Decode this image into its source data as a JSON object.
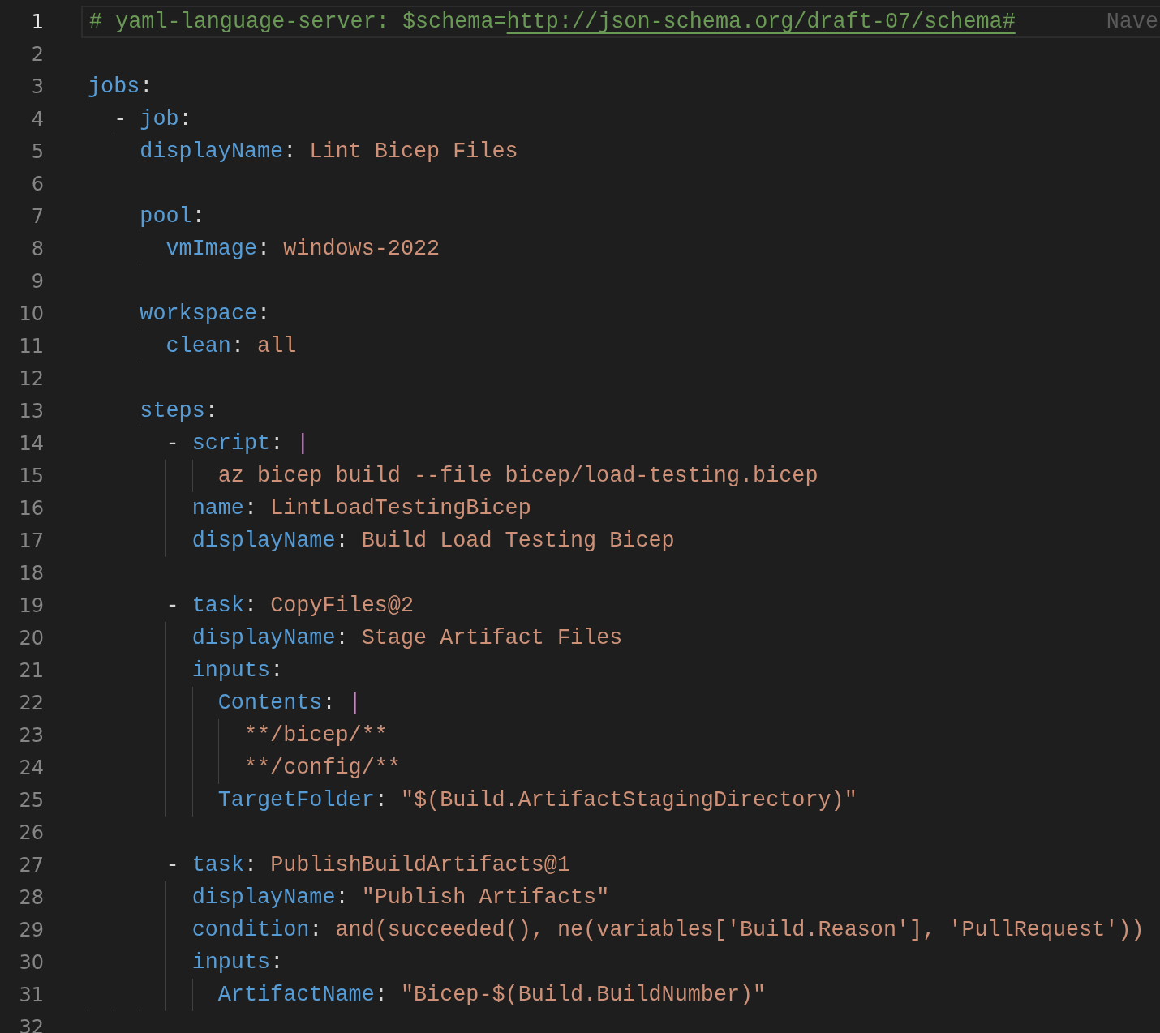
{
  "lines": [
    {
      "number": "1",
      "active": true,
      "tokens": [
        {
          "kind": "comment",
          "text": "# yaml-language-server: $schema="
        },
        {
          "kind": "link",
          "text": "http://json-schema.org/draft-07/schema#"
        }
      ],
      "blame": "Nave"
    },
    {
      "number": "2",
      "active": false
    },
    {
      "number": "3",
      "active": false,
      "tokens": [
        {
          "kind": "key",
          "text": "jobs"
        },
        {
          "kind": "punct",
          "text": ":"
        }
      ]
    },
    {
      "number": "4",
      "active": false,
      "tokens": [
        {
          "kind": "punct",
          "text": "  - "
        },
        {
          "kind": "key",
          "text": "job"
        },
        {
          "kind": "punct",
          "text": ":"
        }
      ]
    },
    {
      "number": "5",
      "active": false,
      "tokens": [
        {
          "kind": "key",
          "text": "    displayName"
        },
        {
          "kind": "punct",
          "text": ": "
        },
        {
          "kind": "string",
          "text": "Lint Bicep Files"
        }
      ]
    },
    {
      "number": "6",
      "active": false
    },
    {
      "number": "7",
      "active": false,
      "tokens": [
        {
          "kind": "key",
          "text": "    pool"
        },
        {
          "kind": "punct",
          "text": ":"
        }
      ]
    },
    {
      "number": "8",
      "active": false,
      "tokens": [
        {
          "kind": "key",
          "text": "      vmImage"
        },
        {
          "kind": "punct",
          "text": ": "
        },
        {
          "kind": "string",
          "text": "windows-2022"
        }
      ]
    },
    {
      "number": "9",
      "active": false
    },
    {
      "number": "10",
      "active": false,
      "tokens": [
        {
          "kind": "key",
          "text": "    workspace"
        },
        {
          "kind": "punct",
          "text": ":"
        }
      ]
    },
    {
      "number": "11",
      "active": false,
      "tokens": [
        {
          "kind": "key",
          "text": "      clean"
        },
        {
          "kind": "punct",
          "text": ": "
        },
        {
          "kind": "string",
          "text": "all"
        }
      ]
    },
    {
      "number": "12",
      "active": false
    },
    {
      "number": "13",
      "active": false,
      "tokens": [
        {
          "kind": "key",
          "text": "    steps"
        },
        {
          "kind": "punct",
          "text": ":"
        }
      ]
    },
    {
      "number": "14",
      "active": false,
      "tokens": [
        {
          "kind": "punct",
          "text": "      - "
        },
        {
          "kind": "key",
          "text": "script"
        },
        {
          "kind": "punct",
          "text": ": "
        },
        {
          "kind": "indicator",
          "text": "|"
        }
      ]
    },
    {
      "number": "15",
      "active": false,
      "tokens": [
        {
          "kind": "string",
          "text": "          az bicep build --file bicep/load-testing.bicep"
        }
      ]
    },
    {
      "number": "16",
      "active": false,
      "tokens": [
        {
          "kind": "key",
          "text": "        name"
        },
        {
          "kind": "punct",
          "text": ": "
        },
        {
          "kind": "string",
          "text": "LintLoadTestingBicep"
        }
      ]
    },
    {
      "number": "17",
      "active": false,
      "tokens": [
        {
          "kind": "key",
          "text": "        displayName"
        },
        {
          "kind": "punct",
          "text": ": "
        },
        {
          "kind": "string",
          "text": "Build Load Testing Bicep"
        }
      ]
    },
    {
      "number": "18",
      "active": false
    },
    {
      "number": "19",
      "active": false,
      "tokens": [
        {
          "kind": "punct",
          "text": "      - "
        },
        {
          "kind": "key",
          "text": "task"
        },
        {
          "kind": "punct",
          "text": ": "
        },
        {
          "kind": "string",
          "text": "CopyFiles@2"
        }
      ]
    },
    {
      "number": "20",
      "active": false,
      "tokens": [
        {
          "kind": "key",
          "text": "        displayName"
        },
        {
          "kind": "punct",
          "text": ": "
        },
        {
          "kind": "string",
          "text": "Stage Artifact Files"
        }
      ]
    },
    {
      "number": "21",
      "active": false,
      "tokens": [
        {
          "kind": "key",
          "text": "        inputs"
        },
        {
          "kind": "punct",
          "text": ":"
        }
      ]
    },
    {
      "number": "22",
      "active": false,
      "tokens": [
        {
          "kind": "key",
          "text": "          Contents"
        },
        {
          "kind": "punct",
          "text": ": "
        },
        {
          "kind": "indicator",
          "text": "|"
        }
      ]
    },
    {
      "number": "23",
      "active": false,
      "tokens": [
        {
          "kind": "string",
          "text": "            **/bicep/**"
        }
      ]
    },
    {
      "number": "24",
      "active": false,
      "tokens": [
        {
          "kind": "string",
          "text": "            **/config/**"
        }
      ]
    },
    {
      "number": "25",
      "active": false,
      "tokens": [
        {
          "kind": "key",
          "text": "          TargetFolder"
        },
        {
          "kind": "punct",
          "text": ": "
        },
        {
          "kind": "string",
          "text": "\"$(Build.ArtifactStagingDirectory)\""
        }
      ]
    },
    {
      "number": "26",
      "active": false
    },
    {
      "number": "27",
      "active": false,
      "tokens": [
        {
          "kind": "punct",
          "text": "      - "
        },
        {
          "kind": "key",
          "text": "task"
        },
        {
          "kind": "punct",
          "text": ": "
        },
        {
          "kind": "string",
          "text": "PublishBuildArtifacts@1"
        }
      ]
    },
    {
      "number": "28",
      "active": false,
      "tokens": [
        {
          "kind": "key",
          "text": "        displayName"
        },
        {
          "kind": "punct",
          "text": ": "
        },
        {
          "kind": "string",
          "text": "\"Publish Artifacts\""
        }
      ]
    },
    {
      "number": "29",
      "active": false,
      "tokens": [
        {
          "kind": "key",
          "text": "        condition"
        },
        {
          "kind": "punct",
          "text": ": "
        },
        {
          "kind": "string",
          "text": "and(succeeded(), ne(variables['Build.Reason'], 'PullRequest'))"
        }
      ]
    },
    {
      "number": "30",
      "active": false,
      "tokens": [
        {
          "kind": "key",
          "text": "        inputs"
        },
        {
          "kind": "punct",
          "text": ":"
        }
      ]
    },
    {
      "number": "31",
      "active": false,
      "tokens": [
        {
          "kind": "key",
          "text": "          ArtifactName"
        },
        {
          "kind": "punct",
          "text": ": "
        },
        {
          "kind": "string",
          "text": "\"Bicep-$(Build.BuildNumber)\""
        }
      ]
    },
    {
      "number": "32",
      "active": false
    }
  ]
}
